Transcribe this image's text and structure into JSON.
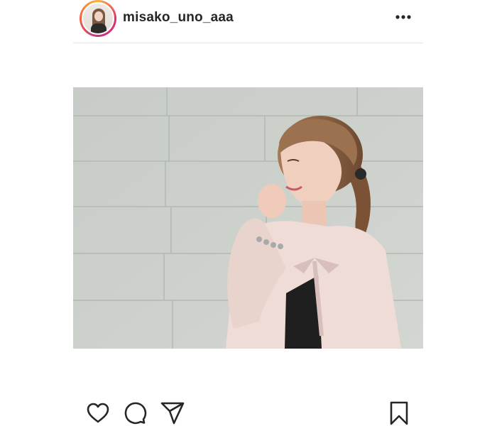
{
  "header": {
    "username": "misako_uno_aaa",
    "avatar_icon": "profile-avatar",
    "more_icon": "more-options-icon"
  },
  "post": {
    "image_description_icon": "post-photo"
  },
  "actions": {
    "like_icon": "heart-icon",
    "comment_icon": "comment-icon",
    "share_icon": "paper-plane-icon",
    "save_icon": "bookmark-icon"
  },
  "colors": {
    "text": "#262626",
    "ring_start": "#f9b43a",
    "ring_end": "#c13584",
    "wall": "#c9cdc8",
    "cardigan": "#efdcd6"
  }
}
